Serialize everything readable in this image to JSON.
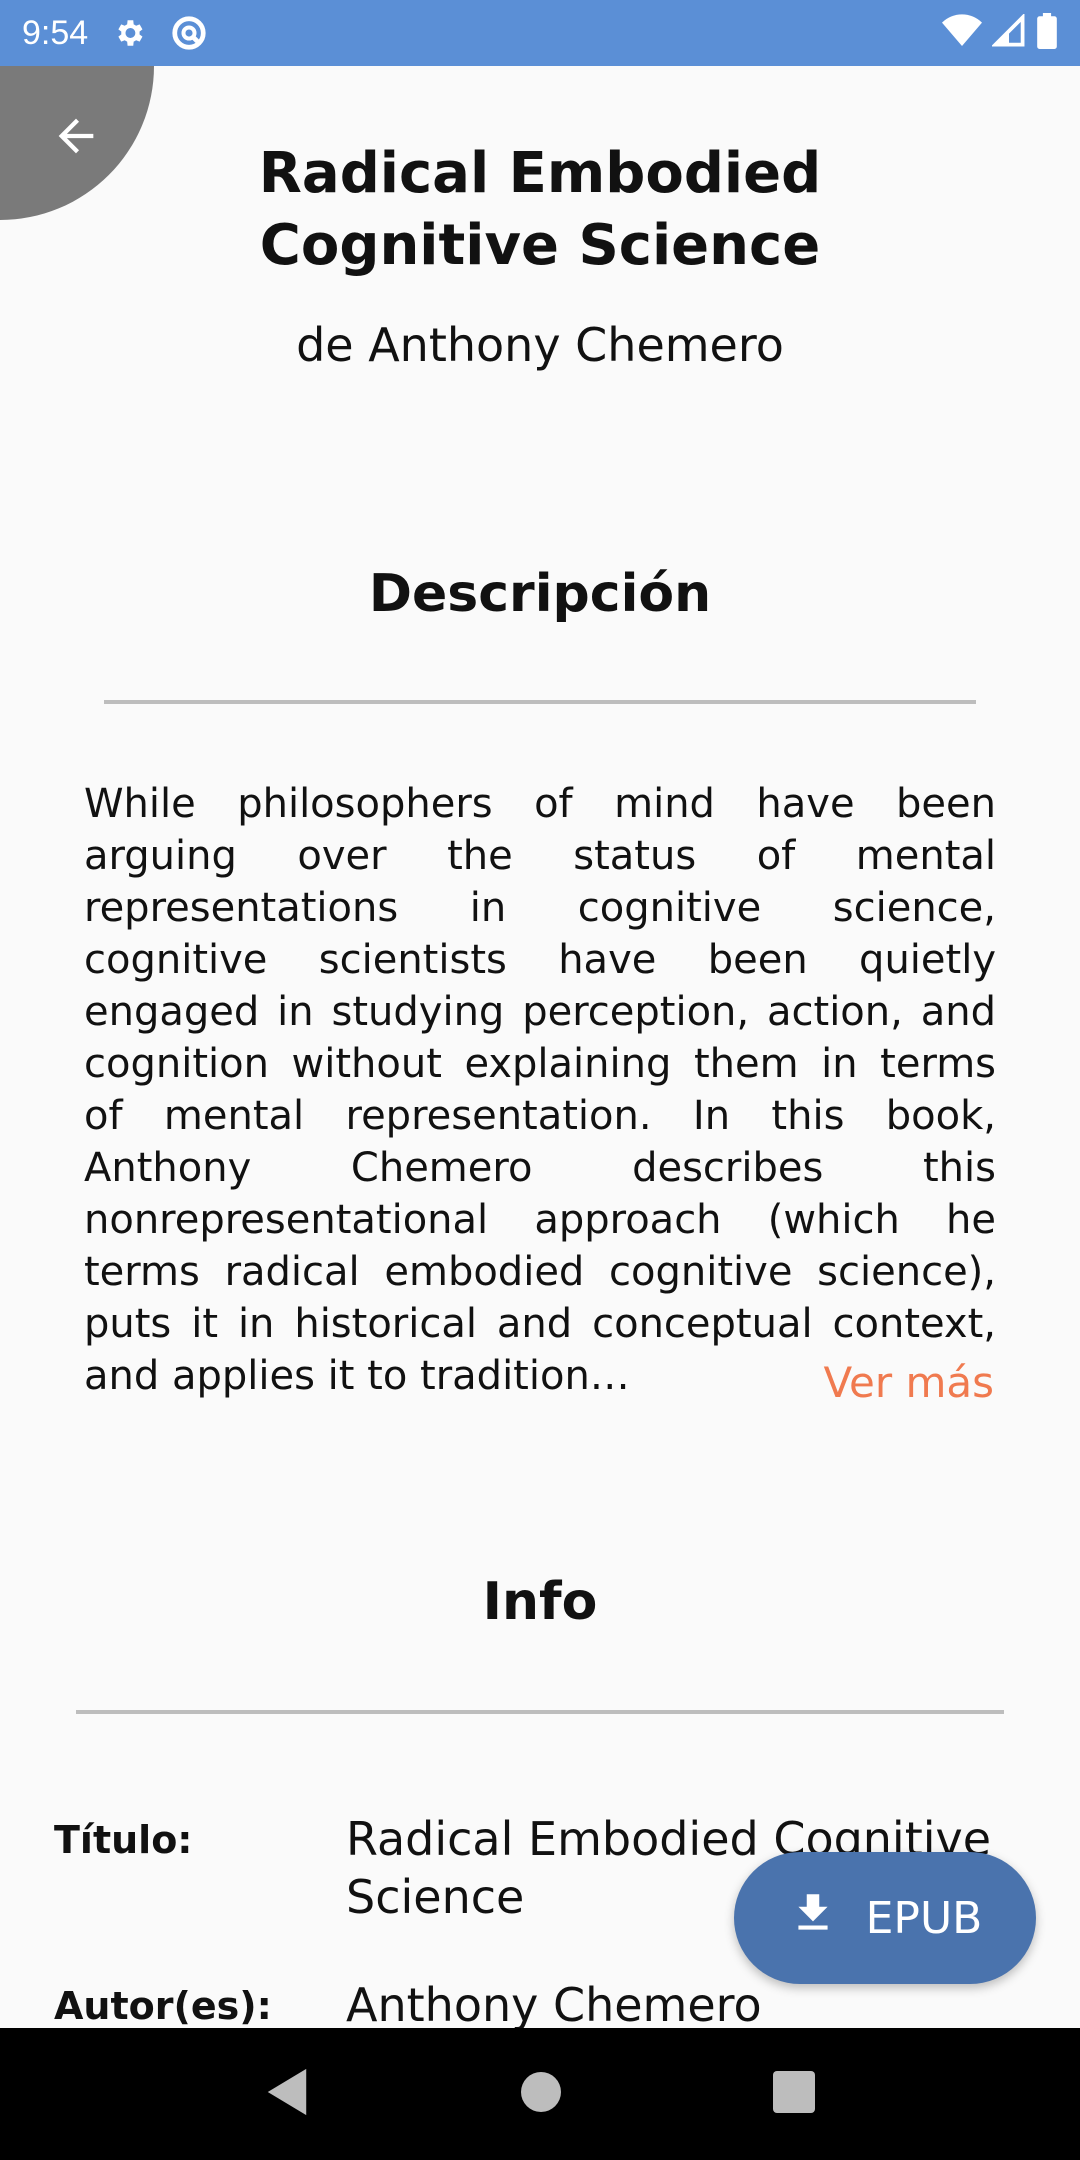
{
  "status_bar": {
    "time": "9:54",
    "icons": [
      "settings-gear-icon",
      "sync-circle-icon",
      "wifi-icon",
      "cell-signal-icon",
      "battery-icon"
    ]
  },
  "header": {
    "back_icon": "arrow-back-icon",
    "title": "Radical Embodied Cognitive Science",
    "author_line": "de Anthony Chemero"
  },
  "description": {
    "heading": "Descripción",
    "text": "While philosophers of mind have been arguing over the status of mental representations in cognitive science, cognitive scientists have been quietly engaged in studying perception, action, and cognition without explaining them in terms of mental representation. In this book, Anthony Chemero describes this nonrepresentational approach (which he terms radical embodied cognitive science), puts it in historical and conceptual context, and applies it to tradition…",
    "more_link": "Ver más"
  },
  "info": {
    "heading": "Info",
    "rows": [
      {
        "label": "Título:",
        "value": "Radical Embodied Cognitive Science"
      },
      {
        "label": "Autor(es):",
        "value": "Anthony Chemero"
      }
    ]
  },
  "fab": {
    "icon": "download-icon",
    "label": "EPUB"
  },
  "nav_bar": {
    "icons": [
      "nav-back-icon",
      "nav-home-icon",
      "nav-recents-icon"
    ]
  },
  "colors": {
    "status_bar": "#5b8fd6",
    "accent_link": "#f07a4f",
    "fab": "#4a73ad"
  }
}
